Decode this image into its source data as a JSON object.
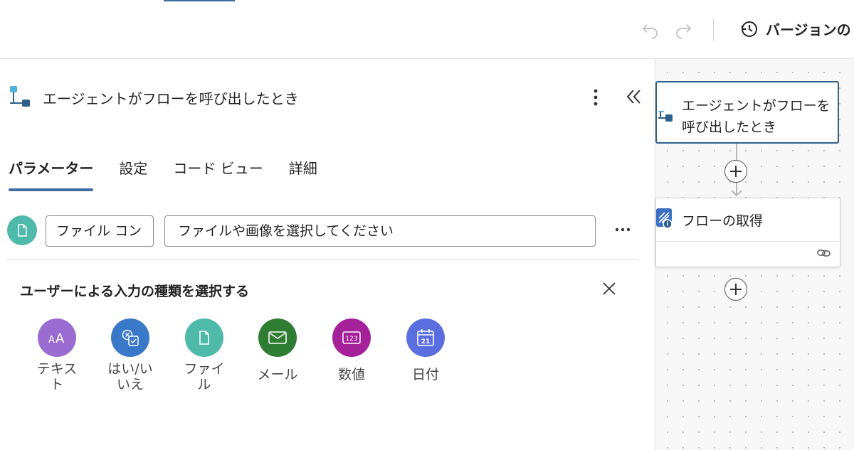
{
  "header": {
    "version_label": "バージョンの"
  },
  "trigger": {
    "title": "エージェントがフローを呼び出したとき"
  },
  "tabs": [
    {
      "label": "パラメーター",
      "active": true
    },
    {
      "label": "設定",
      "active": false
    },
    {
      "label": "コード ビュー",
      "active": false
    },
    {
      "label": "詳細",
      "active": false
    }
  ],
  "param": {
    "name_value": "ファイル コン",
    "description_placeholder": "ファイルや画像を選択してください"
  },
  "chooser": {
    "title": "ユーザーによる入力の種類を選択する",
    "types": [
      {
        "label": "テキスト",
        "color": "#9a6bd1",
        "icon": "text-icon"
      },
      {
        "label": "はい/いいえ",
        "color": "#3a78c9",
        "icon": "yes-no-icon"
      },
      {
        "label": "ファイル",
        "color": "#4fb9aa",
        "icon": "file-icon"
      },
      {
        "label": "メール",
        "color": "#2f7d32",
        "icon": "mail-icon"
      },
      {
        "label": "数値",
        "color": "#a5219a",
        "icon": "number-icon"
      },
      {
        "label": "日付",
        "color": "#5b6ee0",
        "icon": "calendar-icon"
      }
    ]
  },
  "canvas": {
    "card1_title": "エージェントがフローを呼び出したとき",
    "card2_title": "フローの取得"
  },
  "colors": {
    "accent": "#3d6c9e",
    "card_border": "#2f5f8a"
  }
}
